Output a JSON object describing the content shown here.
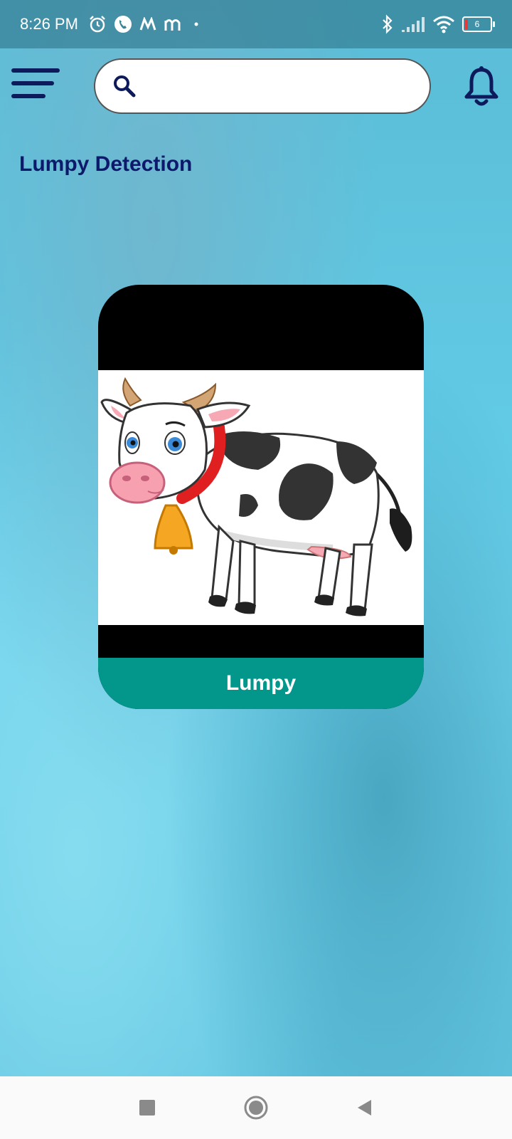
{
  "status_bar": {
    "time": "8:26 PM",
    "battery_level": "6",
    "icons": [
      "alarm-icon",
      "call-icon",
      "app-m-icon",
      "app-m2-icon",
      "dot-icon",
      "bluetooth-icon",
      "signal-icon",
      "wifi-icon",
      "battery-icon"
    ]
  },
  "header": {
    "menu_icon": "hamburger-menu-icon",
    "search": {
      "placeholder": "",
      "value": ""
    },
    "notification_icon": "bell-icon"
  },
  "page": {
    "title": "Lumpy Detection"
  },
  "card": {
    "image": "cow-illustration",
    "label": "Lumpy",
    "label_color": "#02978a"
  },
  "nav_bar": {
    "buttons": [
      "recent-apps-icon",
      "home-icon",
      "back-icon"
    ]
  }
}
